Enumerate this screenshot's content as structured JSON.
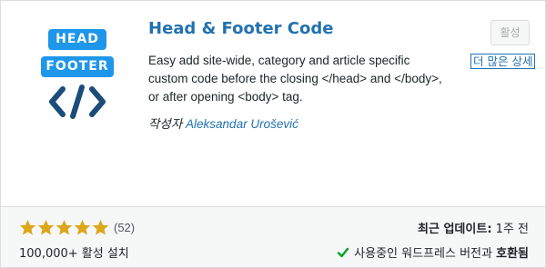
{
  "plugin": {
    "icon_head": "HEAD",
    "icon_footer": "FOOTER",
    "title": "Head & Footer Code",
    "description": "Easy add site-wide, category and article specific custom code before the closing </head> and </body>, or after opening <body> tag.",
    "author_label": "작성자",
    "author_name": "Aleksandar Urošević",
    "activate_label": "활성",
    "more_details_label": "더 많은 상세"
  },
  "stats": {
    "rating": 5,
    "rating_count": "(52)",
    "installs": "100,000+ 활성 설치",
    "last_updated_label": "최근 업데이트:",
    "last_updated_value": "1주 전",
    "compat_prefix": "사용중인 워드프레스 버전과",
    "compat_status": "호환됨"
  },
  "colors": {
    "accent": "#2271b1",
    "icon_blue": "#1e96ea",
    "icon_dark": "#1b4c7a",
    "star": "#dba617",
    "check": "#00a32a"
  }
}
